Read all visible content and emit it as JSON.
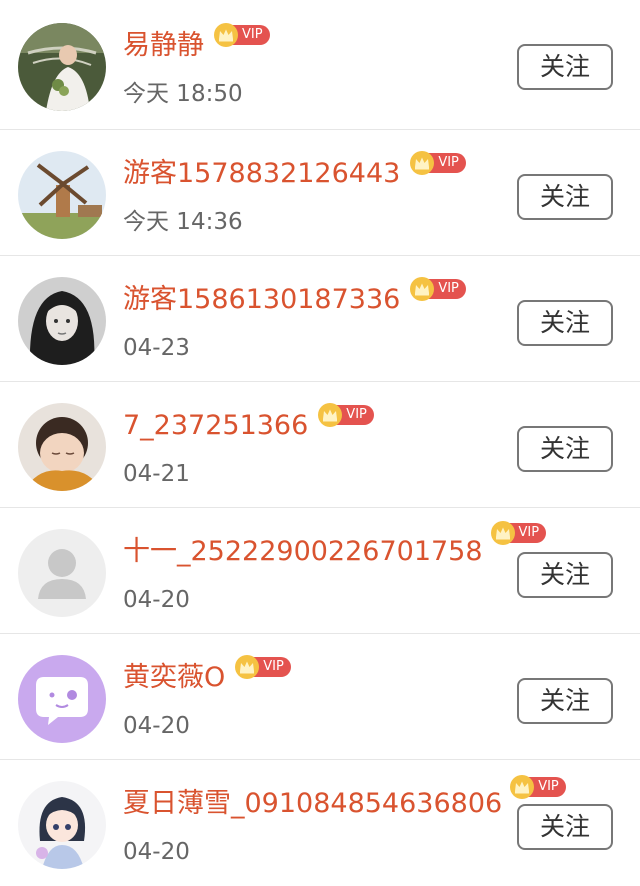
{
  "users": [
    {
      "name": "易静静",
      "vip": "VIP",
      "time": "今天 18:50",
      "follow_label": "关注",
      "avatar": "bride-photo"
    },
    {
      "name": "游客1578832126443",
      "vip": "VIP",
      "time": "今天 14:36",
      "follow_label": "关注",
      "avatar": "windmill-photo"
    },
    {
      "name": "游客1586130187336",
      "vip": "VIP",
      "time": "04-23",
      "follow_label": "关注",
      "avatar": "girl-bw-photo"
    },
    {
      "name": "7_237251366",
      "vip": "VIP",
      "time": "04-21",
      "follow_label": "关注",
      "avatar": "baby-photo"
    },
    {
      "name": "十一_25222900226701758",
      "vip": "VIP",
      "time": "04-20",
      "follow_label": "关注",
      "avatar": "default-person"
    },
    {
      "name": "黄奕薇O",
      "vip": "VIP",
      "time": "04-20",
      "follow_label": "关注",
      "avatar": "purple-chat-face"
    },
    {
      "name": "夏日薄雪_091084854636806",
      "vip": "VIP",
      "time": "04-20",
      "follow_label": "关注",
      "avatar": "anime-girl"
    }
  ],
  "colors": {
    "name": "#d9532f",
    "vip_badge": "#e4534f",
    "crown": "#f5c242",
    "time": "#666666",
    "divider": "#e6e6e6"
  }
}
